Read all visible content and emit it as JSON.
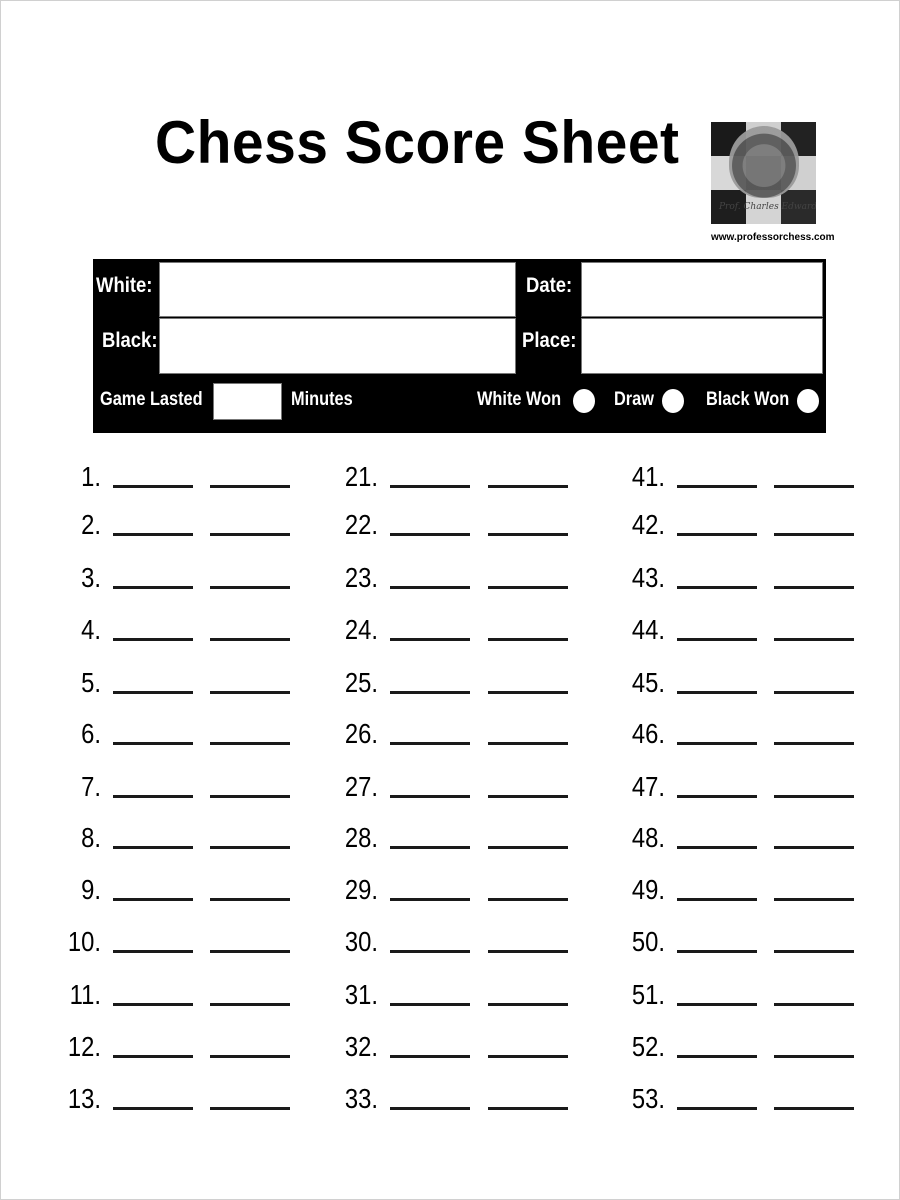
{
  "document": {
    "title": "Chess Score Sheet",
    "logo": {
      "icon": "chess-crown-logo",
      "script_text": "Prof. Charles Edwards",
      "url": "www.professorchess.com"
    }
  },
  "game_info": {
    "white_label": "White:",
    "white_value": "",
    "black_label": "Black:",
    "black_value": "",
    "date_label": "Date:",
    "date_value": "",
    "place_label": "Place:",
    "place_value": "",
    "game_lasted_label": "Game Lasted",
    "game_lasted_value": "",
    "minutes_label": "Minutes",
    "results": [
      {
        "label": "White Won",
        "selected": false
      },
      {
        "label": "Draw",
        "selected": false
      },
      {
        "label": "Black Won",
        "selected": false
      }
    ]
  },
  "moves": {
    "columns": [
      {
        "numbers": [
          "1.",
          "2.",
          "3.",
          "4.",
          "5.",
          "6.",
          "7.",
          "8.",
          "9.",
          "10.",
          "11.",
          "12.",
          "13."
        ]
      },
      {
        "numbers": [
          "21.",
          "22.",
          "23.",
          "24.",
          "25.",
          "26.",
          "27.",
          "28.",
          "29.",
          "30.",
          "31.",
          "32.",
          "33."
        ]
      },
      {
        "numbers": [
          "41.",
          "42.",
          "43.",
          "44.",
          "45.",
          "46.",
          "47.",
          "48.",
          "49.",
          "50.",
          "51.",
          "52.",
          "53."
        ]
      }
    ],
    "white_moves_blank": "______",
    "black_moves_blank": "______"
  }
}
